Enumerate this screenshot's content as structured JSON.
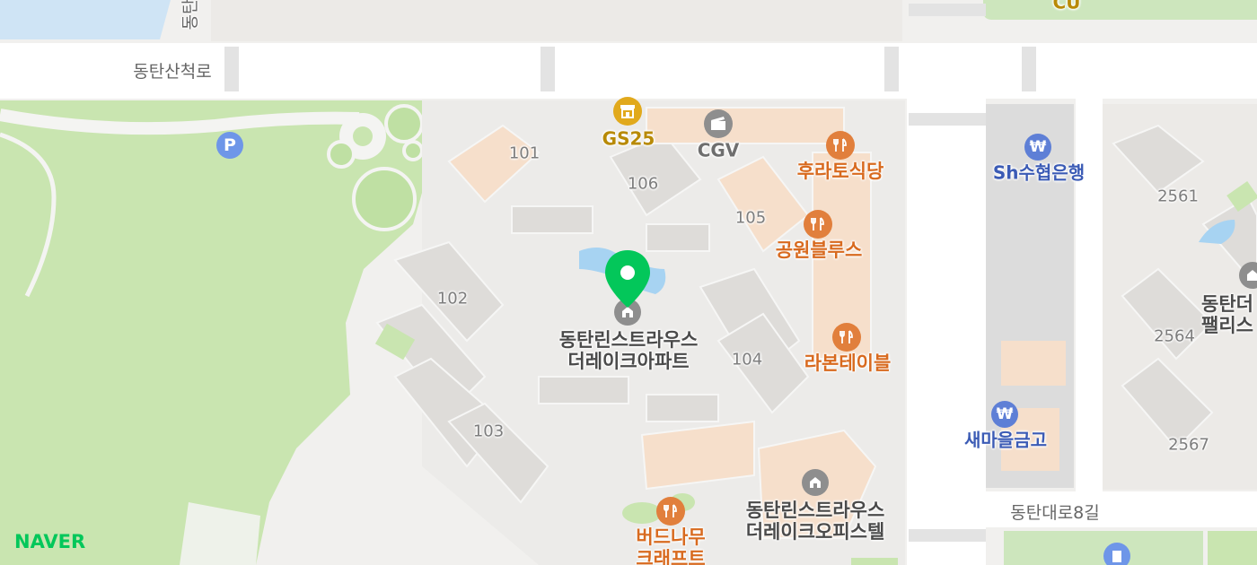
{
  "map": {
    "roads": {
      "dongtan_sancheok": "동탄산척로",
      "dongtan_daero_8gil": "동탄대로8길",
      "vertical_partial": "동탄"
    },
    "buildings": {
      "b101": "101",
      "b102": "102",
      "b103": "103",
      "b104": "104",
      "b105": "105",
      "b106": "106",
      "b2561": "2561",
      "b2564": "2564",
      "b2567": "2567"
    },
    "pois": {
      "gs25": "GS25",
      "cgv": "CGV",
      "cu": "CU",
      "hurato": "후라토식당",
      "gongwon_blues": "공원블루스",
      "labon_table": "라본테이블",
      "sh_bank": "Sh수협은행",
      "saemaul": "새마을금고",
      "dongtan_palace_line1": "동탄더",
      "dongtan_palace_line2": "팰리스",
      "office_line1": "동탄린스트라우스",
      "office_line2": "더레이크오피스텔",
      "birch_line1": "버드나무",
      "birch_line2": "크래프트"
    },
    "selected": {
      "line1": "동탄린스트라우스",
      "line2": "더레이크아파트"
    },
    "parking_symbol": "P",
    "bank_symbol": "₩"
  },
  "brand": {
    "logo_text": "NAVER",
    "accent": "#03c75a"
  },
  "colors": {
    "park": "#c9e5b0",
    "water": "#a7d3f2",
    "road": "#ffffff",
    "food": "#e17f3c",
    "bank": "#5e7fd6",
    "store": "#e1a91c",
    "pin": "#03c75a"
  }
}
